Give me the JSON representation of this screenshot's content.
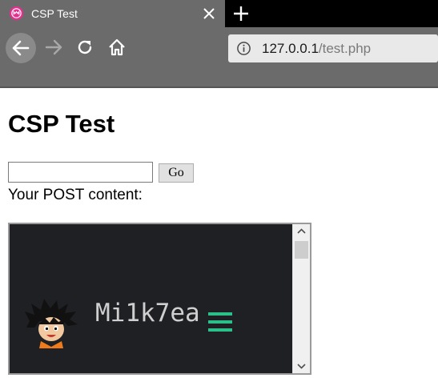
{
  "browser": {
    "tab": {
      "title": "CSP Test",
      "favicon": "firefox-logo-icon",
      "close_icon": "close-icon"
    },
    "new_tab_icon": "plus-icon",
    "toolbar": {
      "back_icon": "arrow-left-icon",
      "forward_icon": "arrow-right-icon",
      "reload_icon": "reload-icon",
      "home_icon": "home-icon"
    },
    "address_bar": {
      "info_icon": "info-icon",
      "host": "127.0.0.1",
      "path": "/test.php"
    },
    "colors": {
      "chrome": "#6b6b6b",
      "tabstrip": "#000000",
      "urlbar": "#e9e9e9"
    }
  },
  "page": {
    "heading": "CSP Test",
    "form": {
      "input_value": "",
      "go_label": "Go"
    },
    "post_label": "Your POST content:",
    "embedded": {
      "brand": "Mi1k7ea",
      "avatar_icon": "cartoon-avatar-icon",
      "menu_icon": "hamburger-menu-icon",
      "colors": {
        "background": "#1f2023",
        "brand_text": "#cfcfcf",
        "menu": "#2bbf8a"
      }
    }
  }
}
